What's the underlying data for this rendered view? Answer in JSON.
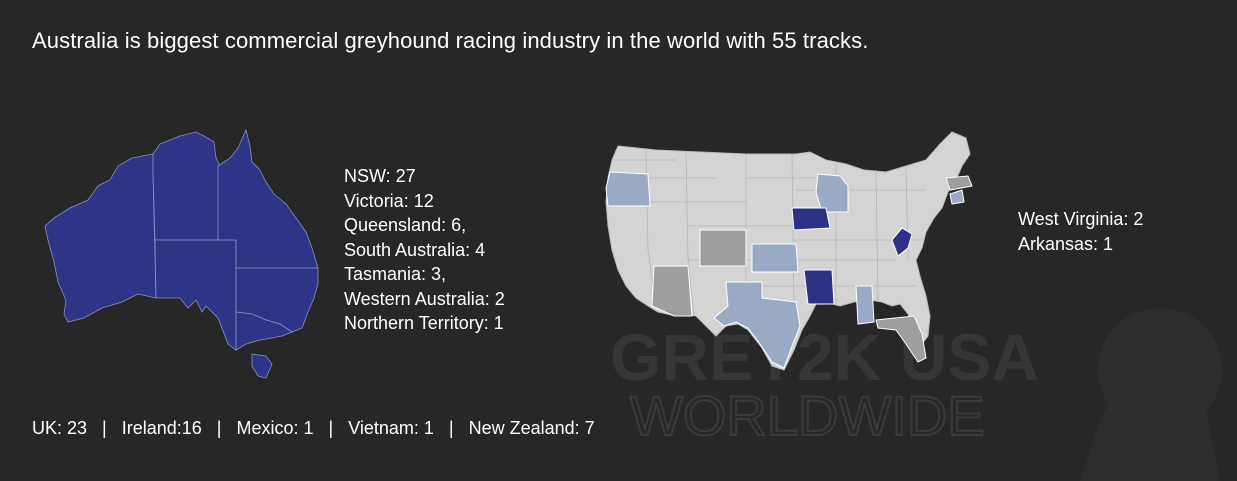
{
  "headline": "Australia is biggest commercial greyhound racing industry in the world with 55 tracks.",
  "colors": {
    "background": "#272727",
    "australia_fill": "#2e3486",
    "us_base": "#d4d4d4",
    "us_dark_blue": "#2d3285",
    "us_light_blue": "#9aaac4",
    "us_grey": "#9e9e9e",
    "text": "#ffffff"
  },
  "australia_tracks": [
    "NSW: 27",
    "Victoria: 12",
    "Queensland: 6,",
    "South Australia: 4",
    "Tasmania: 3,",
    "Western Australia: 2",
    "Northern Territory: 1"
  ],
  "us_tracks": [
    "West Virginia: 2",
    "Arkansas: 1"
  ],
  "other_countries": [
    "UK: 23",
    "Ireland:16",
    "Mexico: 1",
    "Vietnam: 1",
    "New Zealand: 7"
  ],
  "separator": "|",
  "watermark": {
    "line1": "GREY2K USA",
    "line2": "WORLDWIDE"
  }
}
